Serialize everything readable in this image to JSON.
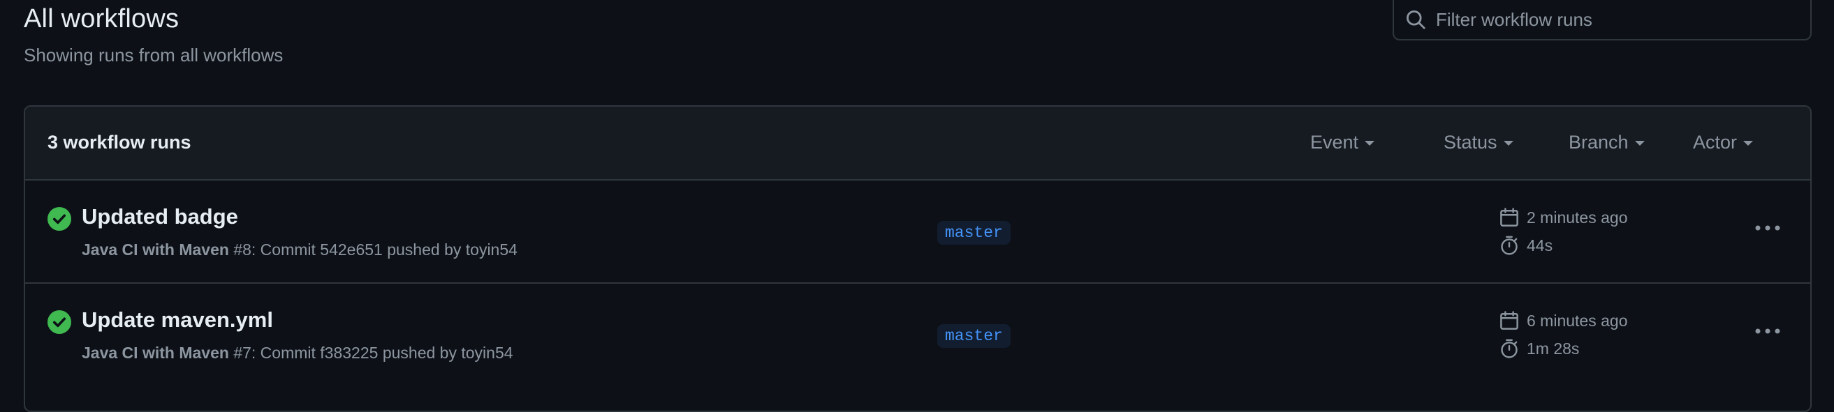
{
  "header": {
    "title": "All workflows",
    "subtitle": "Showing runs from all workflows",
    "filter_placeholder": "Filter workflow runs"
  },
  "runs_box": {
    "count_label": "3 workflow runs",
    "filters": [
      "Event",
      "Status",
      "Branch",
      "Actor"
    ]
  },
  "runs": [
    {
      "title": "Updated badge",
      "workflow": "Java CI with Maven",
      "run_number": "#8",
      "detail": ": Commit 542e651 pushed by toyin54",
      "branch": "master",
      "started": "2 minutes ago",
      "duration": "44s",
      "status": "success"
    },
    {
      "title": "Update maven.yml",
      "workflow": "Java CI with Maven",
      "run_number": "#7",
      "detail": ": Commit f383225 pushed by toyin54",
      "branch": "master",
      "started": "6 minutes ago",
      "duration": "1m 28s",
      "status": "success"
    }
  ],
  "icons": {
    "search": "search-icon",
    "status": "check-circle-icon",
    "calendar": "calendar-icon",
    "stopwatch": "stopwatch-icon",
    "menu": "kebab-horizontal-icon"
  },
  "colors": {
    "background": "#0d1117",
    "success": "#3fb950",
    "branch_text": "#4493f8",
    "branch_bg": "#121d2f",
    "muted": "#8d96a0"
  }
}
